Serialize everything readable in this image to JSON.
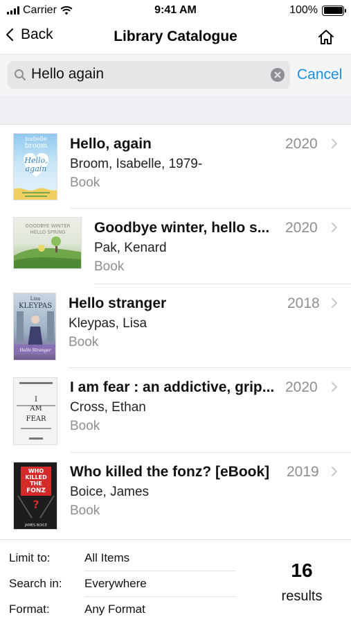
{
  "status_bar": {
    "carrier": "Carrier",
    "time": "9:41 AM",
    "battery": "100%"
  },
  "nav": {
    "back_label": "Back",
    "title": "Library Catalogue",
    "back_icon": "chevron-left-icon",
    "home_icon": "home-icon"
  },
  "search": {
    "value": "Hello again",
    "cancel_label": "Cancel"
  },
  "results": [
    {
      "title": "Hello, again",
      "author": "Broom, Isabelle, 1979-",
      "format": "Book",
      "year": "2020",
      "cover_text": [
        "isabelle",
        "broom",
        "Hello,",
        "again"
      ]
    },
    {
      "title": "Goodbye winter, hello s...",
      "author": "Pak, Kenard",
      "format": "Book",
      "year": "2020",
      "cover_text": [
        "GOODBYE WINTER",
        "HELLO SPRING"
      ]
    },
    {
      "title": "Hello stranger",
      "author": "Kleypas, Lisa",
      "format": "Book",
      "year": "2018",
      "cover_text": [
        "Lisa",
        "KLEYPAS",
        "Hello Stranger"
      ]
    },
    {
      "title": "I am fear : an addictive, grip...",
      "author": "Cross, Ethan",
      "format": "Book",
      "year": "2020",
      "cover_text": [
        "I",
        "AM",
        "FEAR"
      ]
    },
    {
      "title": "Who killed the fonz? [eBook]",
      "author": "Boice, James",
      "format": "Book",
      "year": "2019",
      "cover_text": [
        "WHO",
        "KILLED",
        "THE",
        "FONZ",
        "?",
        "JAMES BOICE"
      ]
    }
  ],
  "filters": [
    {
      "label": "Limit to:",
      "value": "All Items"
    },
    {
      "label": "Search in:",
      "value": "Everywhere"
    },
    {
      "label": "Format:",
      "value": "Any Format"
    }
  ],
  "result_count": {
    "number": "16",
    "label": "results"
  },
  "colors": {
    "accent": "#1a8fe0",
    "secondary_text": "#8e8e93",
    "band": "#efeff4"
  }
}
